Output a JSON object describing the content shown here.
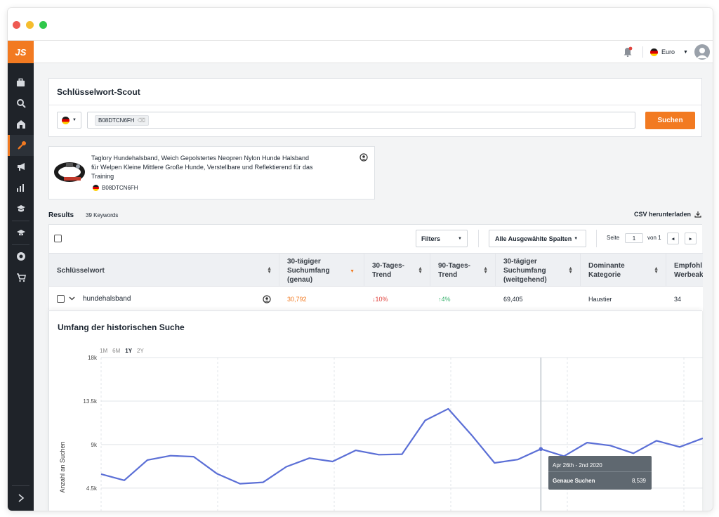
{
  "app": {
    "logo": "JS"
  },
  "header": {
    "currency": "Euro"
  },
  "scout": {
    "title": "Schlüsselwort-Scout",
    "asin_chip": "B08DTCN6FH",
    "search_button": "Suchen"
  },
  "product": {
    "title": "Taglory Hundehalsband, Weich Gepolstertes Neopren Nylon Hunde Halsband für Welpen Kleine Mittlere Große Hunde, Verstellbare und Reflektierend für das Training",
    "asin": "B08DTCN6FH"
  },
  "results": {
    "label": "Results",
    "count": "39 Keywords",
    "csv": "CSV herunterladen",
    "filters": "Filters",
    "columns_select": "Alle Ausgewählte Spalten",
    "page_label": "Seite",
    "page_value": "1",
    "page_of": "von 1"
  },
  "table": {
    "headers": [
      "Schlüsselwort",
      "30-tägiger Suchumfang (genau)",
      "30-Tages-Trend",
      "90-Tages-Trend",
      "30-tägiger Suchumfang (weitgehend)",
      "Dominante Kategorie",
      "Empfohl Werbeak"
    ],
    "row": {
      "keyword": "hundehalsband",
      "exact_volume": "30,792",
      "trend_30": "10%",
      "trend_90": "4%",
      "broad_volume": "69,405",
      "category": "Haustier",
      "recommended": "34"
    }
  },
  "history": {
    "title": "Umfang der historischen Suche",
    "ranges": [
      "1M",
      "6M",
      "1Y",
      "2Y"
    ],
    "active_range": "1Y",
    "tooltip": {
      "date": "Apr 26th - 2nd 2020",
      "label": "Genaue Suchen",
      "value": "8,539"
    }
  },
  "chart_data": {
    "type": "line",
    "ylabel": "Anzahl an Suchen",
    "yticks": [
      "18k",
      "13.5k",
      "9k",
      "4.5k"
    ],
    "ylim": [
      1000,
      18000
    ],
    "grid": true,
    "series": [
      {
        "values": [
          5950,
          5300,
          7400,
          7850,
          7750,
          6000,
          4950,
          5100,
          6700,
          7600,
          7250,
          8400,
          7950,
          8000,
          11500,
          12700,
          10000,
          7100,
          7450,
          8539,
          7800,
          9200,
          8900,
          8100,
          9400,
          8750,
          9650
        ]
      }
    ]
  },
  "colors": {
    "accent": "#f27a21",
    "line": "#5b6fd6",
    "down": "#e0443e",
    "up": "#3cb371",
    "sidebar": "#1f2329"
  }
}
